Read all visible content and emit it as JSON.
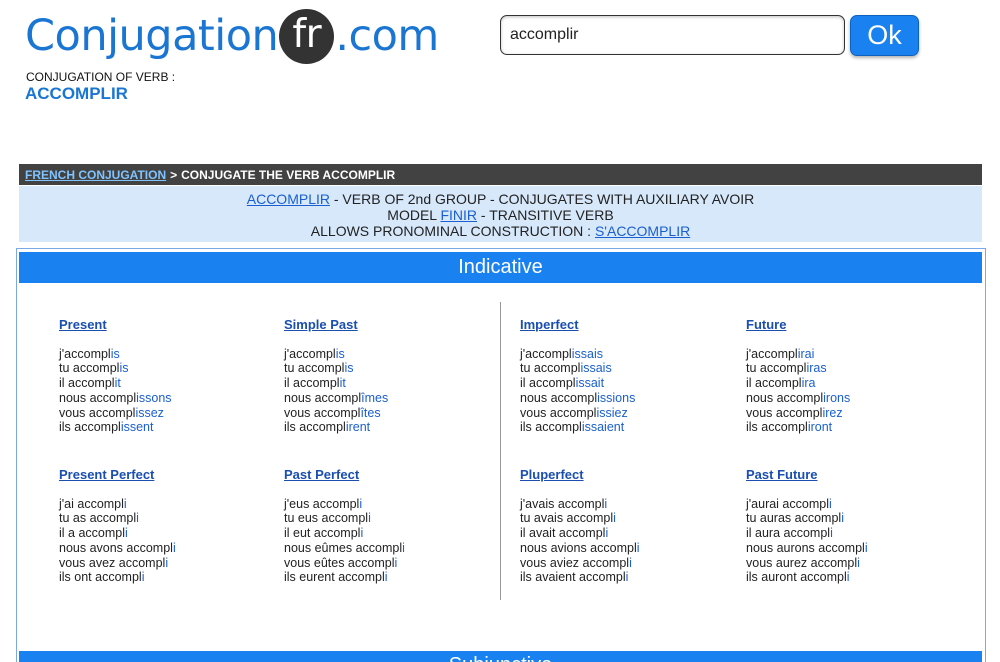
{
  "logo": {
    "part1": "Conjugation",
    "part2": "fr",
    "part3": ".com"
  },
  "verb_label": "CONJUGATION OF VERB :",
  "verb_name": "ACCOMPLIR",
  "search": {
    "value": "accomplir"
  },
  "ok_label": "Ok",
  "breadcrumb": {
    "link": "FRENCH CONJUGATION",
    "sep": ">",
    "current": "CONJUGATE THE VERB ACCOMPLIR"
  },
  "info": {
    "line1_link": "ACCOMPLIR",
    "line1_text": " - VERB OF 2nd GROUP - CONJUGATES WITH AUXILIARY AVOIR",
    "line2_prefix": "MODEL ",
    "line2_link": "FINIR",
    "line2_suffix": " - TRANSITIVE VERB",
    "line3_prefix": "ALLOWS PRONOMINAL CONSTRUCTION : ",
    "line3_link": "S'ACCOMPLIR"
  },
  "mode_title": "Indicative",
  "next_mode_title": "Subjunctive",
  "tenses": [
    {
      "title": "Present",
      "rows": [
        [
          "j'accompl",
          "is"
        ],
        [
          "tu accompl",
          "is"
        ],
        [
          "il accompl",
          "it"
        ],
        [
          "nous accompl",
          "issons"
        ],
        [
          "vous accompl",
          "issez"
        ],
        [
          "ils accompl",
          "issent"
        ]
      ]
    },
    {
      "title": "Simple Past",
      "rows": [
        [
          "j'accompl",
          "is"
        ],
        [
          "tu accompl",
          "is"
        ],
        [
          "il accompl",
          "it"
        ],
        [
          "nous accompl",
          "îmes"
        ],
        [
          "vous accompl",
          "îtes"
        ],
        [
          "ils accompl",
          "irent"
        ]
      ]
    },
    {
      "title": "Imperfect",
      "rows": [
        [
          "j'accompl",
          "issais"
        ],
        [
          "tu accompl",
          "issais"
        ],
        [
          "il accompl",
          "issait"
        ],
        [
          "nous accompl",
          "issions"
        ],
        [
          "vous accompl",
          "issiez"
        ],
        [
          "ils accompl",
          "issaient"
        ]
      ]
    },
    {
      "title": "Future",
      "rows": [
        [
          "j'accompl",
          "irai"
        ],
        [
          "tu accompl",
          "iras"
        ],
        [
          "il accompl",
          "ira"
        ],
        [
          "nous accompl",
          "irons"
        ],
        [
          "vous accompl",
          "irez"
        ],
        [
          "ils accompl",
          "iront"
        ]
      ]
    },
    {
      "title": "Present Perfect",
      "rows": [
        [
          "j'ai accompl",
          "i"
        ],
        [
          "tu as accompl",
          "i"
        ],
        [
          "il a accompl",
          "i"
        ],
        [
          "nous avons accompl",
          "i"
        ],
        [
          "vous avez accompl",
          "i"
        ],
        [
          "ils ont accompl",
          "i"
        ]
      ]
    },
    {
      "title": "Past Perfect",
      "rows": [
        [
          "j'eus accompl",
          "i"
        ],
        [
          "tu eus accompl",
          "i"
        ],
        [
          "il eut accompl",
          "i"
        ],
        [
          "nous eûmes accompl",
          "i"
        ],
        [
          "vous eûtes accompl",
          "i"
        ],
        [
          "ils eurent accompl",
          "i"
        ]
      ]
    },
    {
      "title": "Pluperfect",
      "rows": [
        [
          "j'avais accompl",
          "i"
        ],
        [
          "tu avais accompl",
          "i"
        ],
        [
          "il avait accompl",
          "i"
        ],
        [
          "nous avions accompl",
          "i"
        ],
        [
          "vous aviez accompl",
          "i"
        ],
        [
          "ils avaient accompl",
          "i"
        ]
      ]
    },
    {
      "title": "Past Future",
      "rows": [
        [
          "j'aurai accompl",
          "i"
        ],
        [
          "tu auras accompl",
          "i"
        ],
        [
          "il aura accompl",
          "i"
        ],
        [
          "nous aurons accompl",
          "i"
        ],
        [
          "vous aurez accompl",
          "i"
        ],
        [
          "ils auront accompl",
          "i"
        ]
      ]
    }
  ],
  "colors": {
    "brand": "#1a76d2",
    "header_bar": "#1a82f0",
    "breadcrumb_bg": "#424242",
    "info_bg": "#d6e8fa"
  }
}
